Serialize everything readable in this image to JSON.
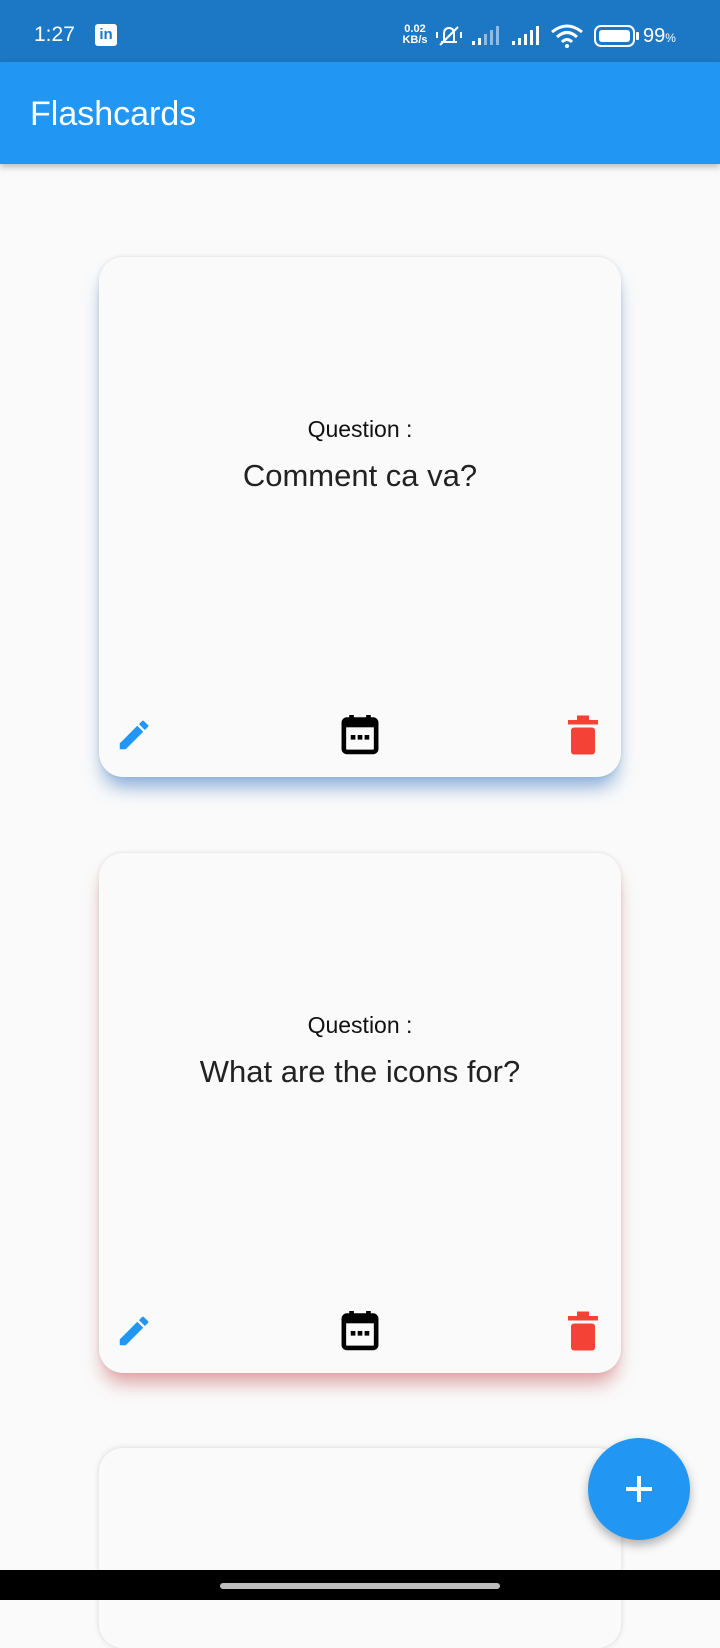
{
  "status_bar": {
    "time": "1:27",
    "notification_icon": "linkedin-icon",
    "net_speed_value": "0.02",
    "net_speed_unit": "KB/s",
    "battery_value": "99",
    "battery_unit": "%"
  },
  "app_bar": {
    "title": "Flashcards"
  },
  "cards": [
    {
      "label": "Question :",
      "question": "Comment ca va?",
      "shadow_color": "#6b9bd1",
      "actions": [
        "pencil-icon",
        "calendar-icon",
        "trash-icon"
      ]
    },
    {
      "label": "Question :",
      "question": "What are the icons for?",
      "shadow_color": "#d88a8a",
      "actions": [
        "pencil-icon",
        "calendar-icon",
        "trash-icon"
      ]
    }
  ],
  "fab": {
    "icon": "plus-icon"
  },
  "colors": {
    "status_bar": "#1c78c4",
    "app_bar": "#2196f3",
    "edit_icon": "#2196f3",
    "calendar_icon": "#000000",
    "delete_icon": "#f44336",
    "background": "#fafafa"
  }
}
